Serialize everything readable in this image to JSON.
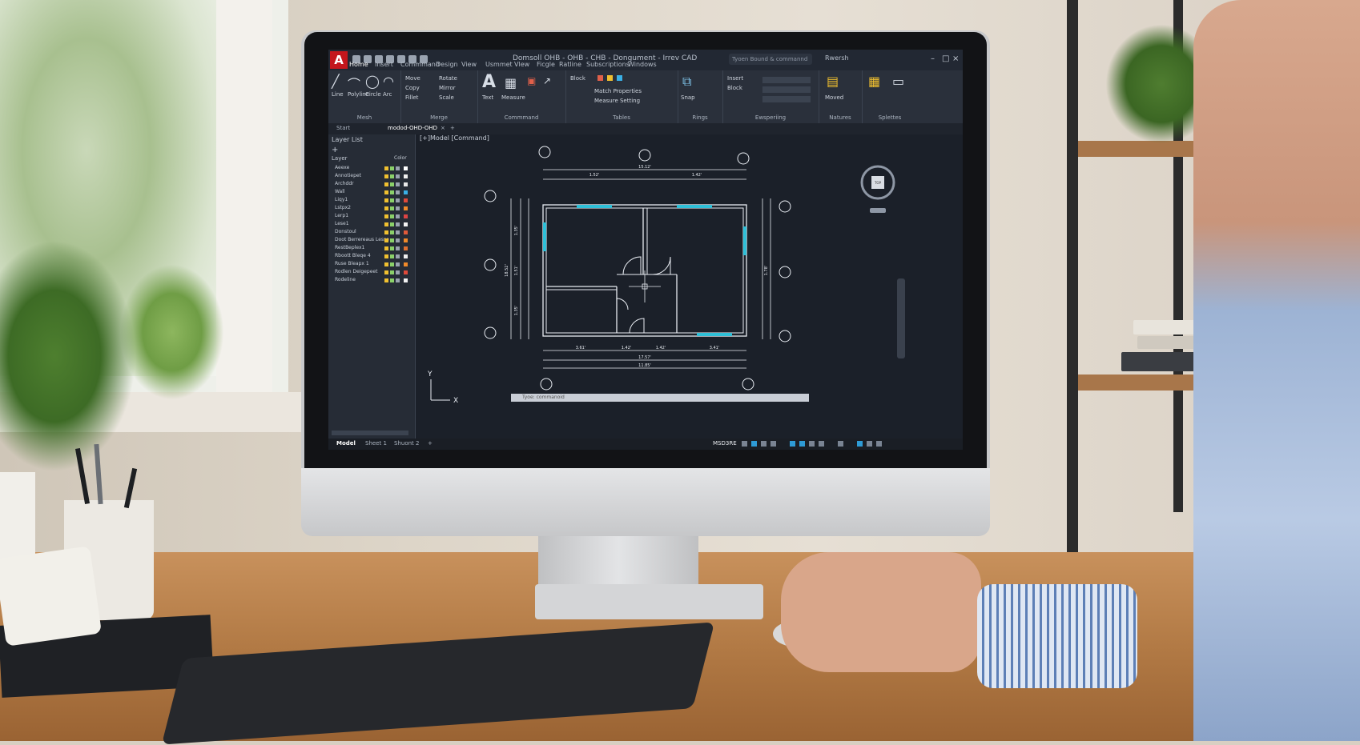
{
  "app": {
    "logo_letter": "A",
    "document_title": "Domsoll OHB - OHB - CHB - Dongument - Irrev CAD",
    "search_placeholder": "Tyoen Bound & commannd",
    "user_label": "Rwersh",
    "ribbon_tabs": [
      "Home",
      "Insert",
      "Commmand",
      "Design",
      "View",
      "Usmmet",
      "Vlew",
      "Ficgle",
      "Ratline",
      "Subscriptions",
      "Windows"
    ],
    "active_tab": "Home"
  },
  "ribbon": {
    "draw_tools": [
      "Line",
      "Polyline",
      "Circle",
      "Arc"
    ],
    "draw_group": "Mesh",
    "modify_tools": [
      "Move",
      "Rotate",
      "Copy",
      "Mirror",
      "Fillet",
      "Scale"
    ],
    "modify_group": "Merge",
    "annotation_tools": [
      "Text",
      "Measure"
    ],
    "annotation_group": "Commmand",
    "layer_group": "Tables",
    "insert_group": "Rings",
    "block_tools": [
      "Insert",
      "Block"
    ],
    "props_group": "Ewsperiing",
    "utilities_group": "Natures",
    "clipboard_group": "Splettes",
    "labels_misc": [
      "Block",
      "Match Properties",
      "Measure Setting",
      "Snap",
      "Moved"
    ]
  },
  "doc_tabs": [
    "Start",
    "modod-OHD-OHD"
  ],
  "viewport_label": "[+]Model [Command]",
  "layer_panel": {
    "title": "Layer List",
    "header": "Layer",
    "col_header": "Color",
    "layers": [
      {
        "name": "Aeexe",
        "color": "#ffffff"
      },
      {
        "name": "Annotiepet",
        "color": "#f0f0f0"
      },
      {
        "name": "Archddr",
        "color": "#e8e8e8"
      },
      {
        "name": "Wall",
        "color": "#3ab0e6"
      },
      {
        "name": "Liqy1",
        "color": "#e04a3a"
      },
      {
        "name": "Lstpx2",
        "color": "#f08a2a"
      },
      {
        "name": "Lerp1",
        "color": "#d44"
      },
      {
        "name": "Lese1",
        "color": "#f3f3f3"
      },
      {
        "name": "Donstoul",
        "color": "#e05a3a"
      },
      {
        "name": "Doot Berrereaus Lesse",
        "color": "#f08a2a"
      },
      {
        "name": "RestBeplex1",
        "color": "#e07030"
      },
      {
        "name": "Rboott Bleqe 4",
        "color": "#f0f0f0"
      },
      {
        "name": "Ruse Bleapx 1",
        "color": "#f08a2a"
      },
      {
        "name": "Rodlen Deigepeet",
        "color": "#e04a3a"
      },
      {
        "name": "Rodeline",
        "color": "#f3f3f3"
      }
    ]
  },
  "drawing": {
    "dims_top": [
      "1.52'",
      "1.42'",
      "15.12'"
    ],
    "dims_bottom": [
      "3.61'",
      "1.42'",
      "1.42'",
      "3.41'",
      "17.57'",
      "11.85'"
    ],
    "dims_left": [
      "1.35'",
      "1.51'",
      "1.35'",
      "18.52'"
    ],
    "dims_right": [
      "1.78'"
    ],
    "ucs_x": "X",
    "ucs_y": "Y",
    "viewcube_top": "TOP",
    "wall_color": "#e8ecf2",
    "window_color": "#2fc0d8"
  },
  "command_line": {
    "placeholder": "Tyoe: commanoid"
  },
  "layout_tabs": [
    {
      "label": "Model",
      "active": true
    },
    {
      "label": "Sheet 1",
      "active": false
    },
    {
      "label": "Shuont 2",
      "active": false
    }
  ],
  "status": {
    "space": "MSD3RE"
  }
}
